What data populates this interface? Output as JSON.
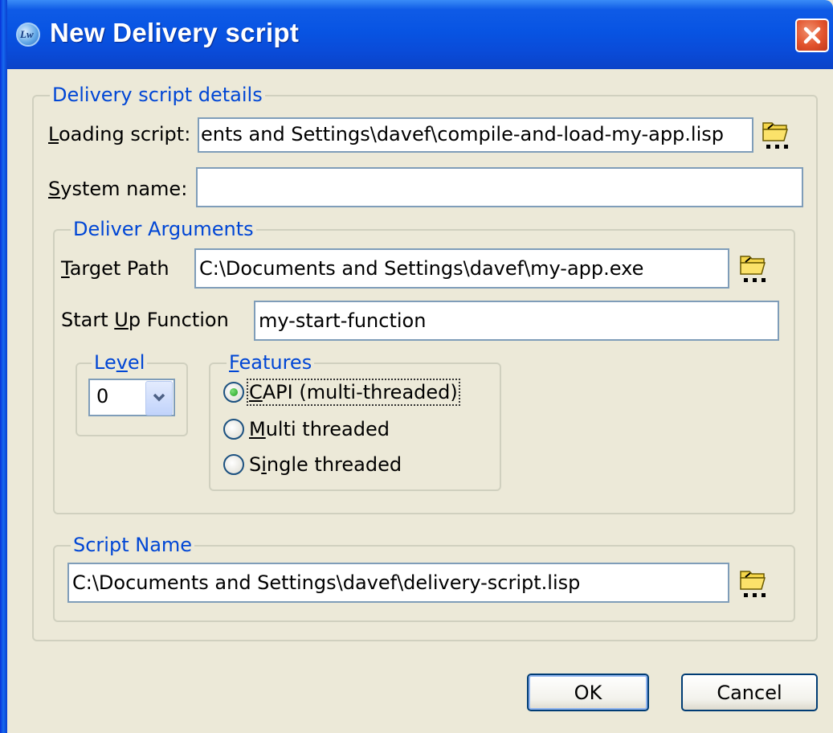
{
  "window": {
    "title": "New Delivery script",
    "app_icon_text": "Lw"
  },
  "details_group": {
    "legend": "Delivery script details",
    "loading_script": {
      "label_underlined": "L",
      "label_rest": "oading script:",
      "value": "ents and Settings\\davef\\compile-and-load-my-app.lisp"
    },
    "system_name": {
      "label_underlined": "S",
      "label_rest": "ystem name:",
      "value": ""
    }
  },
  "deliver_args": {
    "legend": "Deliver Arguments",
    "target_path": {
      "label_underlined": "T",
      "label_rest": "arget Path",
      "value": "C:\\Documents and Settings\\davef\\my-app.exe"
    },
    "startup_function": {
      "label_prefix": "Start ",
      "label_underlined": "U",
      "label_rest": "p Function",
      "value": "my-start-function"
    },
    "level": {
      "legend_prefix": "Le",
      "legend_underlined": "v",
      "legend_rest": "el",
      "value": "0"
    },
    "features": {
      "legend_underlined": "F",
      "legend_rest": "eatures",
      "options": [
        {
          "label": "CAPI (multi-threaded)",
          "underlined": "C",
          "rest": "API (multi-threaded)",
          "checked": true
        },
        {
          "label": "Multi threaded",
          "underlined": "M",
          "rest": "ulti threaded",
          "checked": false
        },
        {
          "label": "Single threaded",
          "prefix": "S",
          "underlined": "i",
          "rest": "ngle threaded",
          "checked": false
        }
      ]
    }
  },
  "script_name": {
    "legend": "Script Name",
    "value": "C:\\Documents and Settings\\davef\\delivery-script.lisp"
  },
  "buttons": {
    "ok": "OK",
    "cancel": "Cancel"
  },
  "icons": [
    "app-icon",
    "close-icon",
    "browse-folder-icon",
    "chevron-down-icon"
  ],
  "colors": {
    "titlebar": "#0A4BD8",
    "dialog_bg": "#ECE9D8",
    "group_legend": "#0046D5",
    "close_button": "#E2532C",
    "field_border": "#7F9DB9"
  }
}
